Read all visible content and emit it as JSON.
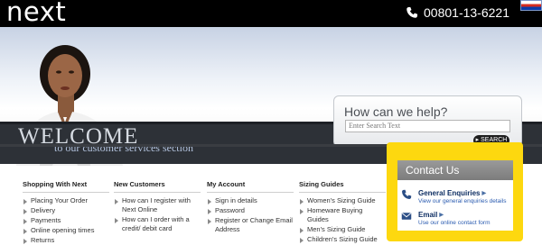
{
  "header": {
    "logo": "next",
    "phone": "00801-13-6221"
  },
  "hero": {
    "welcome_title": "WELCOME",
    "welcome_subtitle_prefix": "to our",
    "welcome_subtitle_highlight": "customer services",
    "welcome_subtitle_suffix": "section"
  },
  "help": {
    "title": "How can we help?",
    "search_placeholder": "Enter Search Text",
    "search_button": "SEARCH"
  },
  "columns": [
    {
      "heading": "Shopping With Next",
      "items": [
        "Placing Your Order",
        "Delivery",
        "Payments",
        "Online opening times",
        "Returns"
      ]
    },
    {
      "heading": "New Customers",
      "items": [
        "How can I register with Next Online",
        "How can I order with a credit/ debit card"
      ]
    },
    {
      "heading": "My Account",
      "items": [
        "Sign in details",
        "Password",
        "Register or Change Email Address"
      ]
    },
    {
      "heading": "Sizing Guides",
      "items": [
        "Women's Sizing Guide",
        "Homeware Buying Guides",
        "Men's Sizing Guide",
        "Children's Sizing Guide"
      ]
    }
  ],
  "contact": {
    "title": "Contact Us",
    "general_title": "General Enquiries",
    "general_desc": "View our general enquiries details",
    "email_title": "Email",
    "email_desc": "Use our online contact form"
  },
  "colors": {
    "topbar": "#000000",
    "contact_highlight": "#fdd80f",
    "link_blue": "#2a5bb0"
  }
}
